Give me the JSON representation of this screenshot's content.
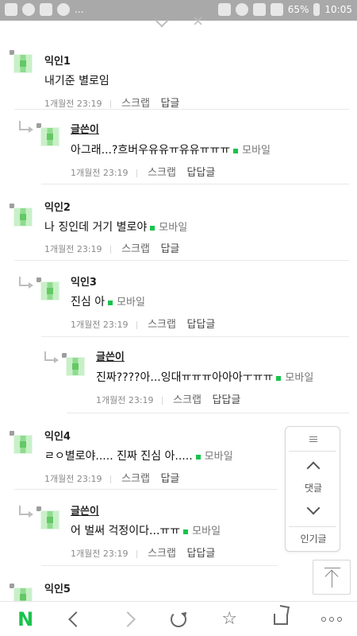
{
  "status_bar": {
    "battery": "65%",
    "time": "10:05",
    "more": "..."
  },
  "comments": [
    {
      "id": "c1",
      "nick": "익인1",
      "text": "내기준 별로임",
      "mobile": "",
      "time": "1개월전 23:19",
      "scrap": "스크랩",
      "reply": "답글"
    },
    {
      "id": "c2",
      "nick": "글쓴이",
      "text": "아그래...?흐버우유유ㅠ유유ㅠㅠㅠ",
      "mobile": "모바일",
      "time": "1개월전 23:19",
      "scrap": "스크랩",
      "reply": "답답글"
    },
    {
      "id": "c3",
      "nick": "익인2",
      "text": "나 징인데 거기 별로야",
      "mobile": "모바일",
      "time": "1개월전 23:19",
      "scrap": "스크랩",
      "reply": "답글"
    },
    {
      "id": "c4",
      "nick": "익인3",
      "text": "진심 아",
      "mobile": "모바일",
      "time": "1개월전 23:19",
      "scrap": "스크랩",
      "reply": "답답글"
    },
    {
      "id": "c5",
      "nick": "글쓴이",
      "text": "진짜????아...잉대ㅠㅠㅠ아아아ㅜㅠㅠ",
      "mobile": "모바일",
      "time": "1개월전 23:19",
      "scrap": "스크랩",
      "reply": "답답글"
    },
    {
      "id": "c6",
      "nick": "익인4",
      "text": "ㄹㅇ별로야..... 진짜 진심 아.....",
      "mobile": "모바일",
      "time": "1개월전 23:19",
      "scrap": "스크랩",
      "reply": "답글"
    },
    {
      "id": "c7",
      "nick": "글쓴이",
      "text": "어 벌써 걱정이다...ㅠㅠ",
      "mobile": "모바일",
      "time": "1개월전 23:19",
      "scrap": "스크랩",
      "reply": "답답글"
    },
    {
      "id": "c8",
      "nick": "익인5",
      "text": "",
      "mobile": "",
      "time": "",
      "scrap": "",
      "reply": ""
    }
  ],
  "side_panel": {
    "comments_label": "댓글",
    "popular_label": "인기글"
  },
  "bottom_nav": {
    "logo": "N"
  },
  "colors": {
    "accent_green": "#19c34c",
    "status_bar_bg": "#a9a9a9"
  }
}
